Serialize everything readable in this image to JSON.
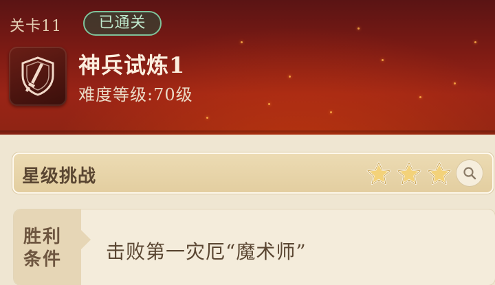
{
  "header": {
    "level_label": "关卡11",
    "cleared_badge": "已通关",
    "stage_name": "神兵试炼1",
    "difficulty": "难度等级:70级",
    "stage_icon": "shield-sword-icon"
  },
  "star_challenge": {
    "title": "星级挑战",
    "stars_earned": 3,
    "stars_total": 3,
    "star_color": "#f3d27a",
    "search_icon": "search-icon"
  },
  "victory": {
    "label": "胜利条件",
    "condition": "击败第一灾厄“魔术师”"
  },
  "colors": {
    "header_red": "#8e2414",
    "cleared_green": "#7fc39b",
    "panel_bg": "#efe6d2"
  }
}
